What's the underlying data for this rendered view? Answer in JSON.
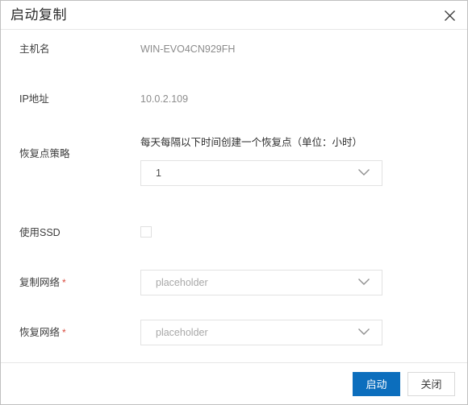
{
  "dialog": {
    "title": "启动复制",
    "close_icon": "close-icon"
  },
  "form": {
    "hostname": {
      "label": "主机名",
      "value": "WIN-EVO4CN929FH"
    },
    "ip_address": {
      "label": "IP地址",
      "value": "10.0.2.109"
    },
    "recovery_point_policy": {
      "label": "恢复点策略",
      "description": "每天每隔以下时间创建一个恢复点（单位：小时）",
      "selected": "1",
      "chevron_icon": "chevron-down-icon"
    },
    "use_ssd": {
      "label": "使用SSD",
      "checked": false
    },
    "replication_network": {
      "label": "复制网络",
      "required_marker": "*",
      "selected": "placeholder",
      "chevron_icon": "chevron-down-icon"
    },
    "recovery_network": {
      "label": "恢复网络",
      "required_marker": "*",
      "selected": "placeholder",
      "chevron_icon": "chevron-down-icon"
    }
  },
  "footer": {
    "start_label": "启动",
    "close_label": "关闭"
  },
  "colors": {
    "primary": "#0c6ebd",
    "required": "#d94a3d",
    "border": "#e2e2e2"
  }
}
